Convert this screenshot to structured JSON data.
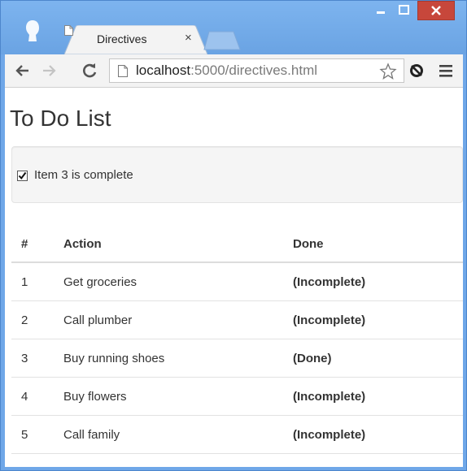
{
  "browser": {
    "tab_title": "Directives",
    "tab_close": "×",
    "url_host": "localhost",
    "url_rest": ":5000/directives.html"
  },
  "page": {
    "title": "To Do List",
    "checkbox_label": "Item 3 is complete",
    "checkbox_checked": true
  },
  "table": {
    "headers": [
      "#",
      "Action",
      "Done"
    ],
    "rows": [
      {
        "num": "1",
        "action": "Get groceries",
        "done": "(Incomplete)"
      },
      {
        "num": "2",
        "action": "Call plumber",
        "done": "(Incomplete)"
      },
      {
        "num": "3",
        "action": "Buy running shoes",
        "done": "(Done)"
      },
      {
        "num": "4",
        "action": "Buy flowers",
        "done": "(Incomplete)"
      },
      {
        "num": "5",
        "action": "Call family",
        "done": "(Incomplete)"
      }
    ]
  },
  "colors": {
    "window_frame": "#6fa7e8",
    "close_button": "#c7473b"
  }
}
